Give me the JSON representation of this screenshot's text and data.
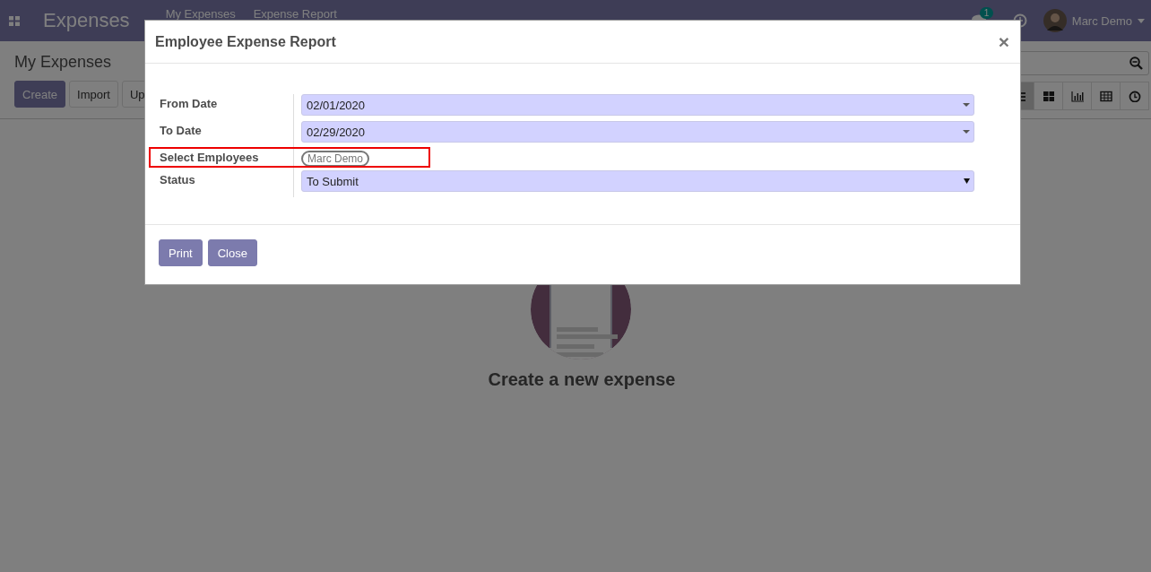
{
  "navbar": {
    "app_name": "Expenses",
    "menus": [
      "My Expenses",
      "Expense Report"
    ],
    "messages_count": "1",
    "user": "Marc Demo"
  },
  "control_panel": {
    "breadcrumb": "My Expenses",
    "buttons": [
      "Create",
      "Import",
      "Up"
    ],
    "views": [
      {
        "kind": "list",
        "selected": true
      },
      {
        "kind": "kanban",
        "selected": false
      },
      {
        "kind": "graph",
        "selected": false
      },
      {
        "kind": "pivot",
        "selected": false
      },
      {
        "kind": "activity",
        "selected": false
      }
    ]
  },
  "empty_state": {
    "title": "Create a new expense"
  },
  "dialog": {
    "title": "Employee Expense Report",
    "close": "×",
    "fields": [
      {
        "kind": "date",
        "label": "From Date",
        "value": "02/01/2020",
        "highlighted": false
      },
      {
        "kind": "date",
        "label": "To Date",
        "value": "02/29/2020",
        "highlighted": false
      },
      {
        "kind": "tags",
        "label": "Select Employees",
        "tags": [
          "Marc Demo"
        ],
        "highlighted": true
      },
      {
        "kind": "select",
        "label": "Status",
        "value": "To Submit",
        "highlighted": false
      }
    ],
    "buttons": [
      "Print",
      "Close"
    ]
  }
}
